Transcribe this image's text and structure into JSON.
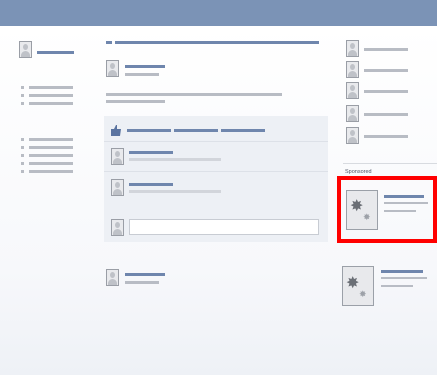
{
  "header": {
    "bar_color": "#7b93b6"
  },
  "right_column": {
    "sponsored_label": "Sponsored"
  },
  "highlight": {
    "color": "#ff0000"
  },
  "icons": {
    "thumbs_up": "thumbs-up-icon",
    "ad_image": "starburst-icon",
    "profile": "person-silhouette-icon"
  }
}
